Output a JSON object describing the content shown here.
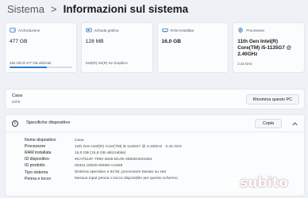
{
  "breadcrumb": {
    "parent": "Sistema",
    "separator": ">",
    "current": "Informazioni sul sistema"
  },
  "cards": [
    {
      "icon": "storage-icon",
      "label": "Archiviazione",
      "value": "477 GB",
      "sub": "284 GB di 477 GB utilizzati",
      "usage_fraction": 0.595
    },
    {
      "icon": "graphics-card-icon",
      "label": "Scheda grafica",
      "value": "128 MB",
      "sub": "Intel(R) Iris(R) Xe Graphics"
    },
    {
      "icon": "ram-icon",
      "label": "RAM installata",
      "value": "16,0 GB",
      "sub": ""
    },
    {
      "icon": "processor-icon",
      "label": "Processore",
      "value": "11th Gen Intel(R) Core(TM) i5-1135G7 @ 2.40GHz",
      "sub": "2.42 GHz"
    }
  ],
  "device": {
    "name": "Casa",
    "model": "82FE",
    "rename_label": "Rinomina questo PC"
  },
  "specs": {
    "title": "Specifiche dispositivo",
    "copy_label": "Copia",
    "rows": [
      {
        "label": "Nome dispositivo",
        "value": "Casa"
      },
      {
        "label": "Processore",
        "value": "11th Gen Intel(R) Core(TM) i5-1135G7 @ 2.40GHz   2.42 GHz"
      },
      {
        "label": "RAM installata",
        "value": "16,0 GB (15,8 GB utilizzabile)"
      },
      {
        "label": "ID dispositivo",
        "value": "9CA7514F-7094-4645-B1AE-48628A531384"
      },
      {
        "label": "ID prodotto",
        "value": "00331-20020-00000-AA828"
      },
      {
        "label": "Tipo sistema",
        "value": "Sistema operativo a 64 bit, processore basato su x64"
      },
      {
        "label": "Penna e tocco",
        "value": "Nessun input penna o tocco disponibile per questo schermo"
      }
    ]
  },
  "watermark": {
    "text": "subito"
  },
  "colors": {
    "accent": "#2d7ad6",
    "background": "#eef2f7",
    "watermark": "#e02f3e"
  }
}
